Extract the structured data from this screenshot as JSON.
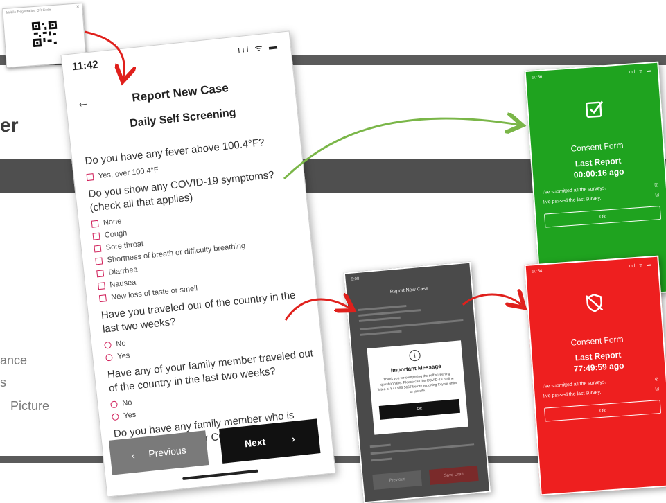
{
  "background": {
    "title_fragment": "er",
    "items": [
      "ance",
      "s",
      "Picture"
    ]
  },
  "qr_popup": {
    "title": "Mobile Registration QR Code",
    "close": "×"
  },
  "main_phone": {
    "time": "11:42",
    "status": "ııl ᯤ ▬",
    "back": "←",
    "title": "Report New Case",
    "subtitle": "Daily Self Screening",
    "q1": "Do you have any fever above 100.4°F?",
    "q1_options": [
      "Yes, over 100.4°F"
    ],
    "q2": "Do you show any COVID-19 symptoms? (check all that applies)",
    "q2_options": [
      "None",
      "Cough",
      "Sore throat",
      "Shortness of breath or difficulty breathing",
      "Diarrhea",
      "Nausea",
      "New loss of taste or smell"
    ],
    "q3": "Have you traveled out of the country in the last two weeks?",
    "q3_options": [
      "No",
      "Yes"
    ],
    "q4": "Have any of your family member traveled out of the country in the last two weeks?",
    "q4_options": [
      "No",
      "Yes"
    ],
    "q5": "Do you have any family member who is under quarantine for COVID-19?",
    "prev_label": "Previous",
    "prev_icon": "‹",
    "next_label": "Next",
    "next_icon": "›"
  },
  "green_phone": {
    "time": "10:56",
    "status": "ııl ᯤ ▬",
    "title": "Consent Form",
    "report": "Last Report",
    "elapsed": "00:00:16 ago",
    "row1": "I've submitted all the surveys.",
    "row2": "I've passed the last survey.",
    "ok": "Ok"
  },
  "red_phone": {
    "time": "10:54",
    "status": "ııl ᯤ ▬",
    "title": "Consent Form",
    "report": "Last Report",
    "elapsed": "77:49:59 ago",
    "row1": "I've submitted all the surveys.",
    "row2": "I've passed the last survey.",
    "ok": "Ok"
  },
  "dark_phone": {
    "time": "9:08",
    "title": "Report New Case",
    "modal_title": "Important Message",
    "modal_text": "Thank you for completing the self screening questionnaire. Please call the COVID-19 hotline listed at 877 555 5667 before reporting to your office or job site.",
    "ok": "Ok",
    "prev": "Previous",
    "save": "Save Draft"
  },
  "colors": {
    "accent_pink": "#d01f59",
    "green": "#1fa31f",
    "red": "#ee1f1f",
    "arrow_red": "#e0201c",
    "arrow_green": "#7ab648"
  }
}
